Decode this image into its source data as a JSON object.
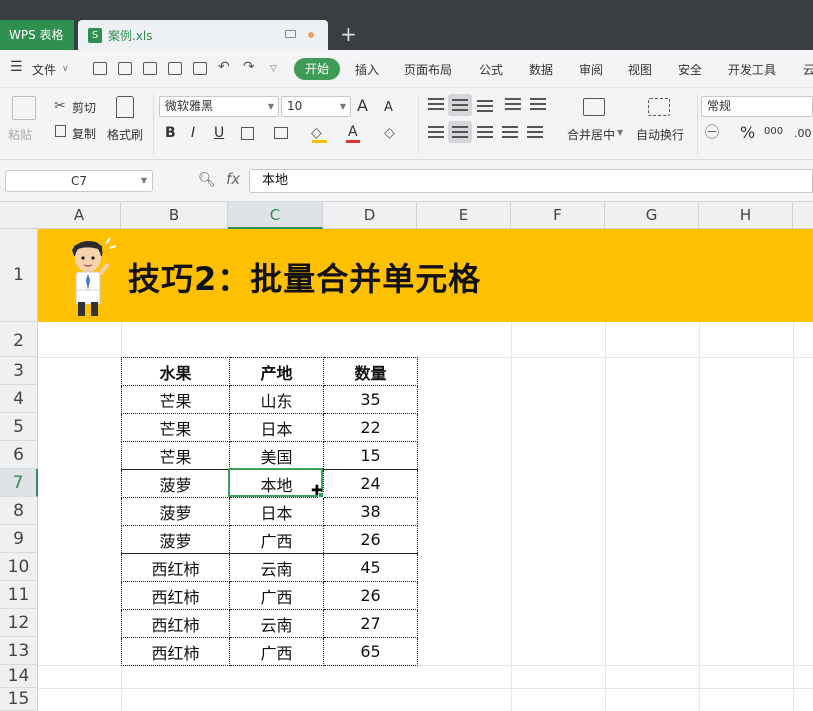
{
  "app": {
    "name": "WPS 表格",
    "file_tab": "案例.xls",
    "file_icon": "S",
    "new_tab": "+"
  },
  "menu": {
    "file": "文件",
    "items": [
      "开始",
      "插入",
      "页面布局",
      "公式",
      "数据",
      "审阅",
      "视图",
      "安全",
      "开发工具",
      "云"
    ]
  },
  "ribbon": {
    "paste": "粘贴",
    "cut": "剪切",
    "copy": "复制",
    "format_painter": "格式刷",
    "font_name": "微软雅黑",
    "font_size": "10",
    "font_grow": "A",
    "font_shrink": "A",
    "bold": "B",
    "italic": "I",
    "underline": "U",
    "font_color_letter": "A",
    "merge_center": "合并居中",
    "wrap_text": "自动换行",
    "number_format": "常规",
    "percent": "%",
    "thousands": "000",
    "decimal": ".00"
  },
  "formula_bar": {
    "cell_ref": "C7",
    "fx": "fx",
    "content": "本地"
  },
  "columns": [
    "A",
    "B",
    "C",
    "D",
    "E",
    "F",
    "G",
    "H"
  ],
  "rows": [
    "1",
    "2",
    "3",
    "4",
    "5",
    "6",
    "7",
    "8",
    "9",
    "10",
    "11",
    "12",
    "13",
    "14",
    "15"
  ],
  "banner": {
    "title": "技巧2：批量合并单元格"
  },
  "table": {
    "headers": [
      "水果",
      "产地",
      "数量"
    ],
    "rows": [
      [
        "芒果",
        "山东",
        "35"
      ],
      [
        "芒果",
        "日本",
        "22"
      ],
      [
        "芒果",
        "美国",
        "15"
      ],
      [
        "菠萝",
        "本地",
        "24"
      ],
      [
        "菠萝",
        "日本",
        "38"
      ],
      [
        "菠萝",
        "广西",
        "26"
      ],
      [
        "西红柿",
        "云南",
        "45"
      ],
      [
        "西红柿",
        "广西",
        "26"
      ],
      [
        "西红柿",
        "云南",
        "27"
      ],
      [
        "西红柿",
        "广西",
        "65"
      ]
    ]
  },
  "colors": {
    "accent": "#2f8f4e",
    "banner": "#fec000",
    "titlebar": "#3a3d42"
  }
}
